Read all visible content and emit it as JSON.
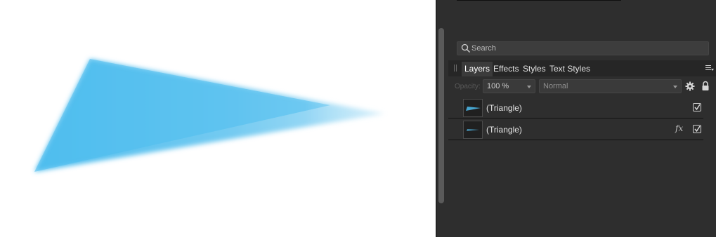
{
  "canvas": {
    "shape": "triangle",
    "fill_color": "#4fbdee",
    "background": "#ffffff"
  },
  "panel": {
    "search": {
      "placeholder": "Search",
      "value": ""
    },
    "tabs": [
      {
        "label": "Layers",
        "active": true
      },
      {
        "label": "Effects",
        "active": false
      },
      {
        "label": "Styles",
        "active": false
      },
      {
        "label": "Text Styles",
        "active": false
      }
    ],
    "opacity_label": "Opacity:",
    "opacity_value": "100 %",
    "blend_mode": "Normal",
    "layers": [
      {
        "name": "(Triangle)",
        "visible": true,
        "has_fx": false
      },
      {
        "name": "(Triangle)",
        "visible": true,
        "has_fx": true,
        "fx_label": "fx"
      }
    ],
    "icons": {
      "search": "search-icon",
      "panel_menu": "hamburger-menu-icon",
      "settings": "gear-icon",
      "lock": "lock-icon",
      "grip": "grip-handle-icon"
    },
    "colors": {
      "panel_bg": "#2e2e2e",
      "tab_bar_bg": "#262626",
      "accent_shape": "#4fbdee"
    }
  }
}
